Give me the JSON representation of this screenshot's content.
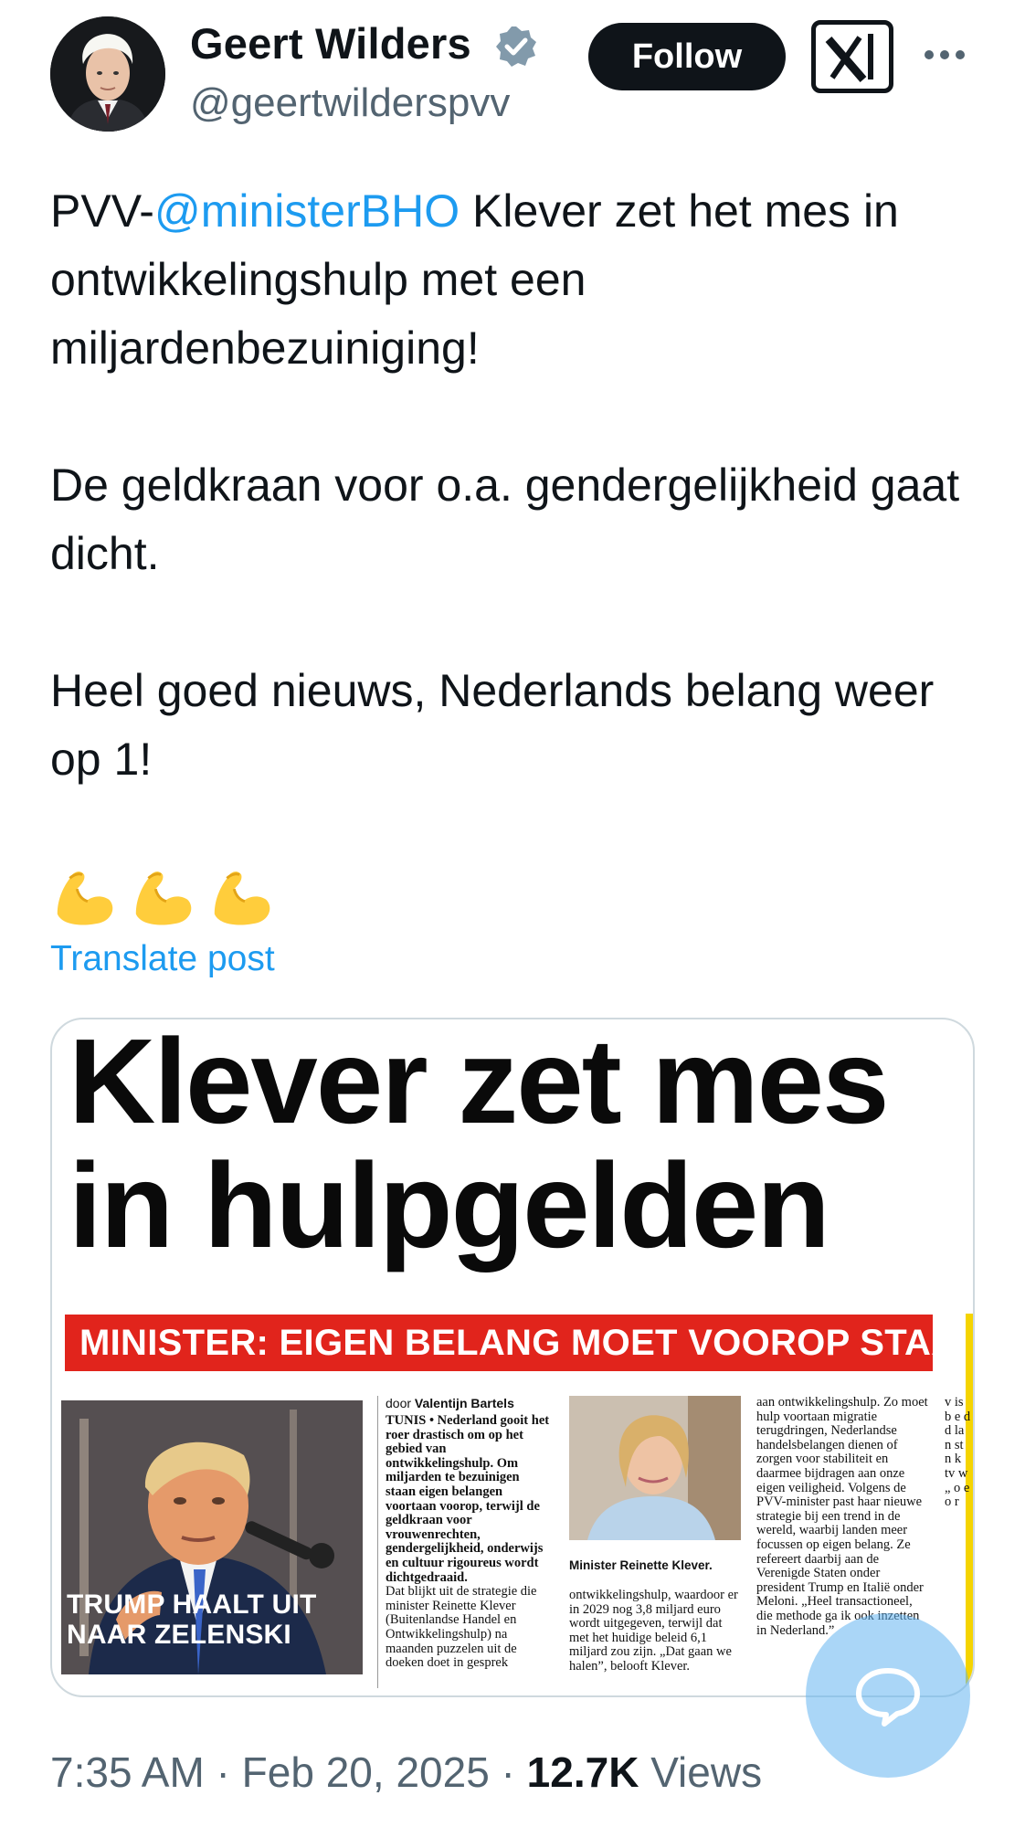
{
  "author": {
    "name": "Geert Wilders",
    "handle": "@geertwilderspvv",
    "verified": true,
    "avatar": "avatar-photo"
  },
  "actions": {
    "follow_label": "Follow",
    "grok_icon": "grok-icon",
    "more_icon": "more-dots-icon"
  },
  "tweet": {
    "line1_prefix": "PVV-",
    "mention": "@ministerBHO",
    "line1_rest": " Klever zet het mes in ontwikkelingshulp met een miljardenbezuiniging!",
    "paragraph2": "De geldkraan voor o.a. gendergelijkheid gaat dicht.",
    "paragraph3": "Heel goed nieuws, Nederlands belang weer op 1!",
    "emojis": [
      "flexed-biceps-icon",
      "flexed-biceps-icon",
      "flexed-biceps-icon"
    ],
    "translate_label": "Translate post"
  },
  "media": {
    "headline_line1": "Klever zet mes",
    "headline_line2": "in hulpgelden",
    "banner": "MINISTER: EIGEN BELANG MOET VOOROP STAAN",
    "trump_caption_line1": "TRUMP HAALT UIT",
    "trump_caption_line2": "NAAR ZELENSKI",
    "byline_prefix": "door ",
    "byline_name": "Valentijn Bartels",
    "col1_lead": "TUNIS • Nederland gooit het roer drastisch om op het gebied van ontwikkelingshulp. Om miljarden te bezuinigen staan eigen belangen voortaan voorop, terwijl de geldkraan voor vrouwenrechten, gendergelijkheid, onderwijs en cultuur rigoureus wordt dichtgedraaid.",
    "col1_body": "Dat blijkt uit de strategie die minister Reinette Klever (Buitenlandse Handel en Ontwikkelingshulp) na maanden puzzelen uit de doeken doet in gesprek",
    "minister_caption": "Minister Reinette Klever.",
    "col2_body": "ontwikkelingshulp, waardoor er in 2029 nog 3,8 miljard euro wordt uitgegeven, terwijl dat met het huidige beleid 6,1 miljard zou zijn. „Dat gaan we halen”, belooft Klever.",
    "col3_body": "aan ontwikkelingshulp. Zo moet hulp voortaan migratie terugdringen, Nederlandse handelsbelangen dienen of zorgen voor stabiliteit en daarmee bijdragen aan onze eigen veiligheid. Volgens de PVV-minister past haar nieuwe strategie bij een trend in de wereld, waarbij landen meer focussen op eigen belang. Ze refereert daarbij aan de Verenigde Staten onder president Trump en Italië onder Meloni. „Heel transactioneel, die methode ga ik ook inzetten in Nederland.”",
    "col4_body": "v is b e d d la n st n k tv w „ o e o r"
  },
  "footer": {
    "time": "7:35 AM",
    "separator": " · ",
    "date": "Feb 20, 2025",
    "views_count": "12.7K",
    "views_label": " Views"
  },
  "fab_icon": "chat-bubble-icon"
}
